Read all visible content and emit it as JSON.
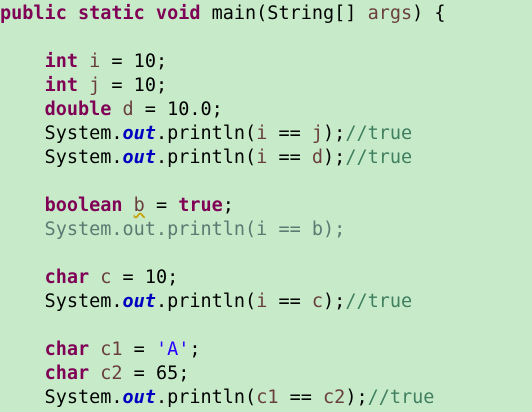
{
  "lines": [
    {
      "segments": [
        {
          "text": "public static void",
          "cls": "kw"
        },
        {
          "text": " main(String[] ",
          "cls": ""
        },
        {
          "text": "args",
          "cls": "var"
        },
        {
          "text": ") {",
          "cls": ""
        }
      ]
    },
    {
      "segments": []
    },
    {
      "segments": [
        {
          "text": "    ",
          "cls": ""
        },
        {
          "text": "int",
          "cls": "kw"
        },
        {
          "text": " ",
          "cls": ""
        },
        {
          "text": "i",
          "cls": "var"
        },
        {
          "text": " = 10;",
          "cls": ""
        }
      ]
    },
    {
      "segments": [
        {
          "text": "    ",
          "cls": ""
        },
        {
          "text": "int",
          "cls": "kw"
        },
        {
          "text": " ",
          "cls": ""
        },
        {
          "text": "j",
          "cls": "var"
        },
        {
          "text": " = 10;",
          "cls": ""
        }
      ]
    },
    {
      "segments": [
        {
          "text": "    ",
          "cls": ""
        },
        {
          "text": "double",
          "cls": "kw"
        },
        {
          "text": " ",
          "cls": ""
        },
        {
          "text": "d",
          "cls": "var"
        },
        {
          "text": " = 10.0;",
          "cls": ""
        }
      ]
    },
    {
      "segments": [
        {
          "text": "    System.",
          "cls": ""
        },
        {
          "text": "out",
          "cls": "field"
        },
        {
          "text": ".println(",
          "cls": ""
        },
        {
          "text": "i",
          "cls": "var"
        },
        {
          "text": " == ",
          "cls": ""
        },
        {
          "text": "j",
          "cls": "var"
        },
        {
          "text": ");",
          "cls": ""
        },
        {
          "text": "//true",
          "cls": "comment"
        }
      ]
    },
    {
      "segments": [
        {
          "text": "    System.",
          "cls": ""
        },
        {
          "text": "out",
          "cls": "field"
        },
        {
          "text": ".println(",
          "cls": ""
        },
        {
          "text": "i",
          "cls": "var"
        },
        {
          "text": " == ",
          "cls": ""
        },
        {
          "text": "d",
          "cls": "var"
        },
        {
          "text": ");",
          "cls": ""
        },
        {
          "text": "//true",
          "cls": "comment"
        }
      ]
    },
    {
      "segments": []
    },
    {
      "segments": [
        {
          "text": "    ",
          "cls": ""
        },
        {
          "text": "boolean",
          "cls": "kw"
        },
        {
          "text": " ",
          "cls": ""
        },
        {
          "text": "b",
          "cls": "var warn"
        },
        {
          "text": " = ",
          "cls": ""
        },
        {
          "text": "true",
          "cls": "kw"
        },
        {
          "text": ";",
          "cls": ""
        }
      ]
    },
    {
      "segments": [
        {
          "text": "    System.out.println(i == b);",
          "cls": "gray"
        }
      ]
    },
    {
      "segments": []
    },
    {
      "segments": [
        {
          "text": "    ",
          "cls": ""
        },
        {
          "text": "char",
          "cls": "kw"
        },
        {
          "text": " ",
          "cls": ""
        },
        {
          "text": "c",
          "cls": "var"
        },
        {
          "text": " = 10;",
          "cls": ""
        }
      ]
    },
    {
      "segments": [
        {
          "text": "    System.",
          "cls": ""
        },
        {
          "text": "out",
          "cls": "field"
        },
        {
          "text": ".println(",
          "cls": ""
        },
        {
          "text": "i",
          "cls": "var"
        },
        {
          "text": " == ",
          "cls": ""
        },
        {
          "text": "c",
          "cls": "var"
        },
        {
          "text": ");",
          "cls": ""
        },
        {
          "text": "//true",
          "cls": "comment"
        }
      ]
    },
    {
      "segments": []
    },
    {
      "segments": [
        {
          "text": "    ",
          "cls": ""
        },
        {
          "text": "char",
          "cls": "kw"
        },
        {
          "text": " ",
          "cls": ""
        },
        {
          "text": "c1",
          "cls": "var"
        },
        {
          "text": " = ",
          "cls": ""
        },
        {
          "text": "'A'",
          "cls": "str"
        },
        {
          "text": ";",
          "cls": ""
        }
      ]
    },
    {
      "segments": [
        {
          "text": "    ",
          "cls": ""
        },
        {
          "text": "char",
          "cls": "kw"
        },
        {
          "text": " ",
          "cls": ""
        },
        {
          "text": "c2",
          "cls": "var"
        },
        {
          "text": " = 65;",
          "cls": ""
        }
      ]
    },
    {
      "segments": [
        {
          "text": "    System.",
          "cls": ""
        },
        {
          "text": "out",
          "cls": "field"
        },
        {
          "text": ".println(",
          "cls": ""
        },
        {
          "text": "c1",
          "cls": "var"
        },
        {
          "text": " == ",
          "cls": ""
        },
        {
          "text": "c2",
          "cls": "var"
        },
        {
          "text": ");",
          "cls": ""
        },
        {
          "text": "//true",
          "cls": "comment"
        }
      ]
    }
  ],
  "colors": {
    "background": "#c7ebc9",
    "keyword": "#7f0055",
    "static_field": "#0000c0",
    "comment": "#3f7f5f",
    "string": "#2a00ff",
    "variable": "#6a3e3e"
  }
}
